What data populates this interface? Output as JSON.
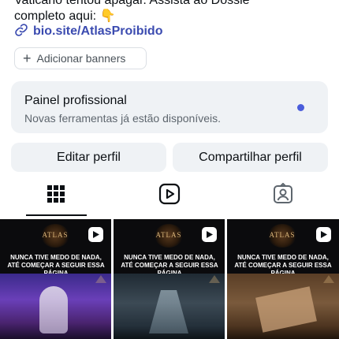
{
  "profile": {
    "bio_line_1": "Vaticano tentou apagar. Assista ao Dossiê",
    "bio_line_2": "completo aqui: 👇",
    "link_text": "bio.site/AtlasProibido",
    "add_banners_label": "Adicionar banners"
  },
  "pro_panel": {
    "title": "Painel profissional",
    "subtitle": "Novas ferramentas já estão disponíveis."
  },
  "actions": {
    "edit_label": "Editar perfil",
    "share_label": "Compartilhar perfil"
  },
  "tabs": [
    {
      "icon": "grid-icon",
      "active": true
    },
    {
      "icon": "reels-icon",
      "active": false
    },
    {
      "icon": "tagged-icon",
      "active": false
    }
  ],
  "posts": [
    {
      "logo": "ATLAS",
      "headline": "NUNCA TIVE MEDO DE NADA, ATÉ COMEÇAR A SEGUIR ESSA PÁGINA",
      "type": "reel"
    },
    {
      "logo": "ATLAS",
      "headline": "NUNCA TIVE MEDO DE NADA, ATÉ COMEÇAR A SEGUIR ESSA PÁGINA",
      "type": "reel"
    },
    {
      "logo": "ATLAS",
      "headline": "NUNCA TIVE MEDO DE NADA, ATÉ COMEÇAR A SEGUIR ESSA PÁGINA",
      "type": "reel"
    }
  ],
  "colors": {
    "link": "#3b4bb0",
    "panel_bg": "#eff2f5",
    "notification_dot": "#4a5ddb",
    "text": "#0c1014"
  }
}
